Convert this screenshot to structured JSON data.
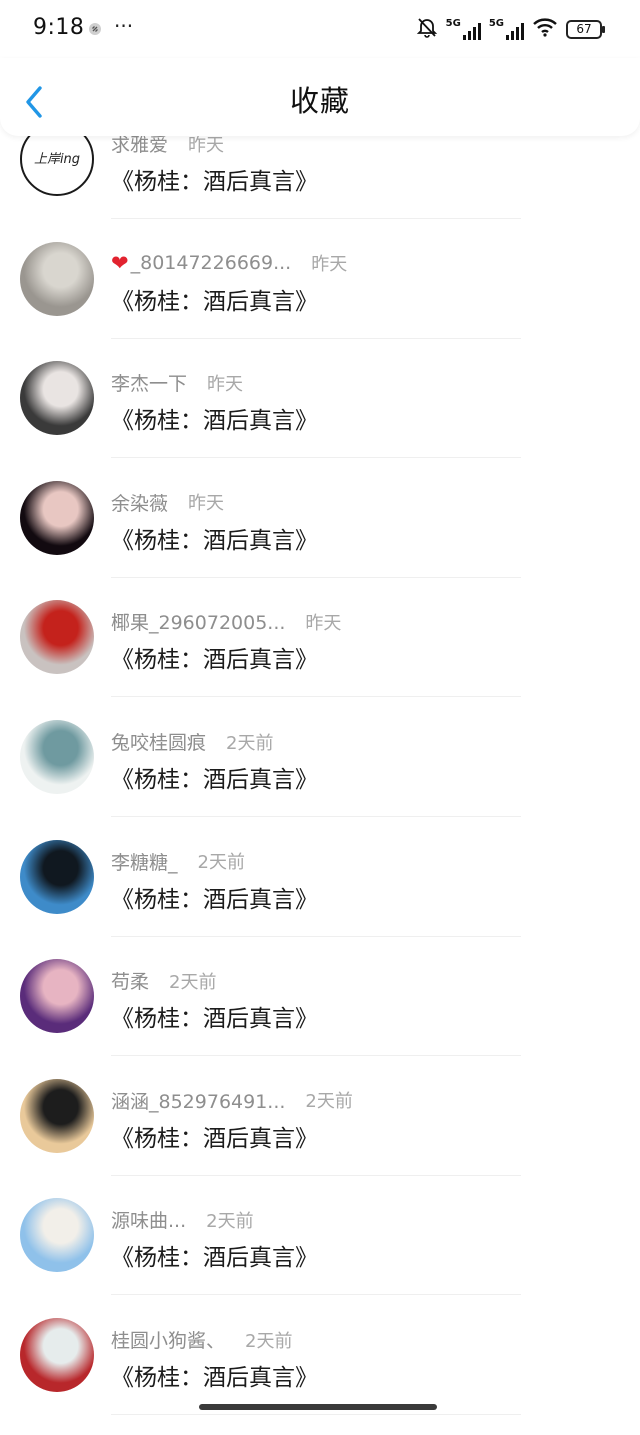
{
  "status_bar": {
    "time": "9:18",
    "more": "···",
    "network_1": "5G",
    "network_2": "5G",
    "battery": "67"
  },
  "header": {
    "title": "收藏",
    "back_icon": "chevron-left-icon"
  },
  "items": [
    {
      "user": "求雅爱",
      "time": "昨天",
      "title": "《杨桂：酒后真言》",
      "heart": false,
      "avatar_colors": [
        "#ffffff",
        "#222222"
      ],
      "avatar_text": "上岸ing"
    },
    {
      "user": "_80147226669...",
      "time": "昨天",
      "title": "《杨桂：酒后真言》",
      "heart": true,
      "avatar_colors": [
        "#9a9690",
        "#d9d6cf"
      ]
    },
    {
      "user": "李杰一下",
      "time": "昨天",
      "title": "《杨桂：酒后真言》",
      "heart": false,
      "avatar_colors": [
        "#3a3a3a",
        "#e9e4e2"
      ]
    },
    {
      "user": "余染薇",
      "time": "昨天",
      "title": "《杨桂：酒后真言》",
      "heart": false,
      "avatar_colors": [
        "#120a10",
        "#e8c7c2"
      ]
    },
    {
      "user": "椰果_296072005...",
      "time": "昨天",
      "title": "《杨桂：酒后真言》",
      "heart": false,
      "avatar_colors": [
        "#c9c2c0",
        "#c4221c"
      ]
    },
    {
      "user": "兔咬桂圆痕",
      "time": "2天前",
      "title": "《杨桂：酒后真言》",
      "heart": false,
      "avatar_colors": [
        "#eef2f1",
        "#6f9aa0"
      ]
    },
    {
      "user": "李糖糖_",
      "time": "2天前",
      "title": "《杨桂：酒后真言》",
      "heart": false,
      "avatar_colors": [
        "#3e8bc9",
        "#101820"
      ]
    },
    {
      "user": "苟柔",
      "time": "2天前",
      "title": "《杨桂：酒后真言》",
      "heart": false,
      "avatar_colors": [
        "#5a2c7a",
        "#e7b4c2"
      ]
    },
    {
      "user": "涵涵_852976491...",
      "time": "2天前",
      "title": "《杨桂：酒后真言》",
      "heart": false,
      "avatar_colors": [
        "#e9c99a",
        "#1d1d1d"
      ]
    },
    {
      "user": "源味曲...",
      "time": "2天前",
      "title": "《杨桂：酒后真言》",
      "heart": false,
      "avatar_colors": [
        "#8fc1ea",
        "#f2efe9"
      ]
    },
    {
      "user": "桂圆小狗酱、",
      "time": "2天前",
      "title": "《杨桂：酒后真言》",
      "heart": false,
      "avatar_colors": [
        "#b8272b",
        "#e6ecec"
      ]
    }
  ]
}
